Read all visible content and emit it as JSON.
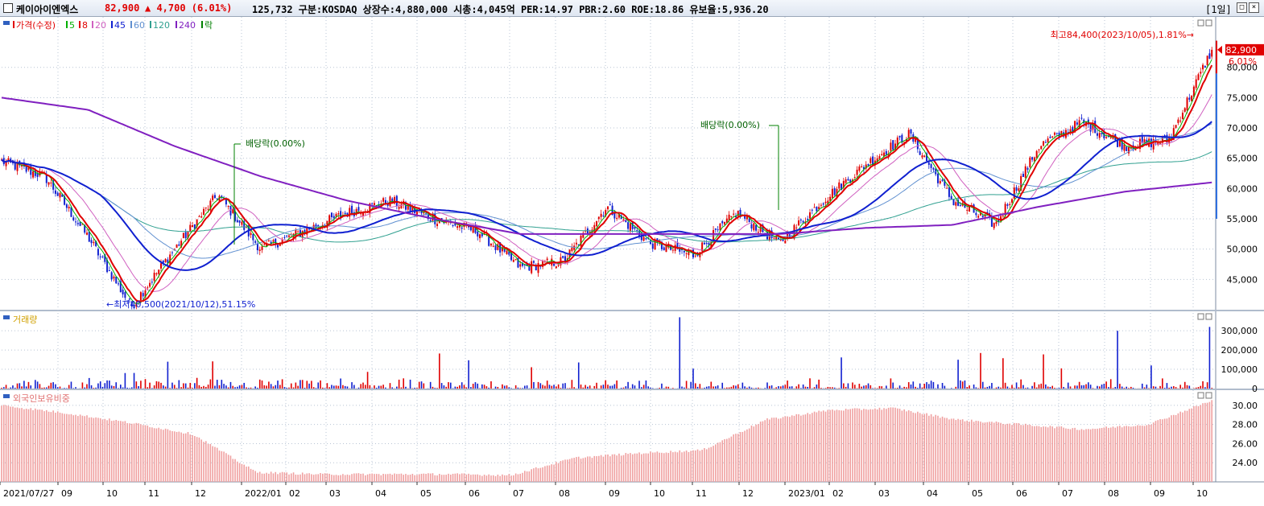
{
  "header": {
    "name": "케이아이엔엑스",
    "price": "82,900",
    "change": "▲ 4,700 (6.01%)",
    "info": "125,732  구분:KOSDAQ 상장수:4,880,000 시총:4,045억 PER:14.97 PBR:2.60 ROE:18.86 유보율:5,936.20",
    "period": "[1일]",
    "btn_max": "□",
    "btn_close": "×"
  },
  "price_panel": {
    "legend": [
      {
        "label": "가격(수정)",
        "color": "#e00000"
      },
      {
        "label": "5",
        "color": "#00b000"
      },
      {
        "label": "8",
        "color": "#e00000"
      },
      {
        "label": "20",
        "color": "#d060c0"
      },
      {
        "label": "45",
        "color": "#1020d0"
      },
      {
        "label": "60",
        "color": "#6090d0"
      },
      {
        "label": "120",
        "color": "#30a090"
      },
      {
        "label": "240",
        "color": "#8020c0"
      },
      {
        "label": "락",
        "color": "#008000"
      }
    ],
    "current_price_label": "82,900",
    "current_pct_label": "6.01%",
    "high_annotation": "최고84,400(2023/10/05),1.81%→",
    "low_annotation": "←최저40,500(2021/10/12),51.15%",
    "dividend1": "배당락(0.00%)",
    "dividend2": "배당락(0.00%)"
  },
  "volume_panel": {
    "legend": "거래량"
  },
  "foreign_panel": {
    "legend": "외국인보유비중"
  },
  "colors": {
    "up": "#e00000",
    "down": "#1020d0",
    "ma240": "#8020c0",
    "grid": "#b8c4d4"
  },
  "chart_data": [
    {
      "type": "line",
      "title": "가격(수정)",
      "y_ticks": [
        45000,
        50000,
        55000,
        60000,
        65000,
        70000,
        75000,
        80000
      ],
      "y_tick_labels": [
        "45,000",
        "50,000",
        "55,000",
        "60,000",
        "65,000",
        "70,000",
        "75,000",
        "80,000"
      ],
      "ylim": [
        40000,
        87000
      ],
      "x_labels": [
        "2021/07/27",
        "09",
        "10",
        "11",
        "12",
        "2022/01",
        "02",
        "03",
        "04",
        "05",
        "06",
        "07",
        "08",
        "09",
        "10",
        "11",
        "12",
        "2023/01",
        "02",
        "03",
        "04",
        "05",
        "06",
        "07",
        "08",
        "09",
        "10"
      ],
      "series": [
        {
          "name": "가격(수정)",
          "x": [
            "2021/07/27",
            "2021/08",
            "2021/09",
            "2021/10/12",
            "2021/11",
            "2021/11 late",
            "2021/12",
            "2022/01",
            "2022/02",
            "2022/03",
            "2022/04",
            "2022/05",
            "2022/06",
            "2022/07",
            "2022/08",
            "2022/09",
            "2022/10",
            "2022/11",
            "2022/12",
            "2023/01",
            "2023/02",
            "2023/03",
            "2023/04",
            "2023/05",
            "2023/06",
            "2023/07",
            "2023/08",
            "2023/09",
            "2023/10/05"
          ],
          "values": [
            64500,
            62000,
            52000,
            40500,
            50000,
            59000,
            50000,
            53000,
            56000,
            58000,
            55000,
            53000,
            47000,
            48000,
            57000,
            51000,
            49000,
            56000,
            51000,
            58000,
            64000,
            69000,
            58000,
            54000,
            67000,
            71000,
            67000,
            68000,
            82900
          ]
        },
        {
          "name": "240",
          "x": [
            "2021/07/27",
            "2021/09",
            "2021/11",
            "2022/01",
            "2022/03",
            "2022/05",
            "2022/07",
            "2022/09",
            "2022/11",
            "2023/01",
            "2023/03",
            "2023/05",
            "2023/07",
            "2023/09",
            "2023/10"
          ],
          "values": [
            75000,
            73000,
            67000,
            62000,
            58000,
            55000,
            52500,
            52500,
            52500,
            52500,
            53500,
            54000,
            57000,
            59500,
            61000
          ]
        }
      ]
    },
    {
      "type": "bar",
      "title": "거래량",
      "y_ticks": [
        0,
        100000,
        200000,
        300000
      ],
      "y_tick_labels": [
        "0",
        "100,000",
        "200,000",
        "300,000"
      ],
      "ylim": [
        0,
        380000
      ]
    },
    {
      "type": "area",
      "title": "외국인보유비중",
      "y_ticks": [
        24,
        26,
        28,
        30
      ],
      "y_tick_labels": [
        "24.00",
        "26.00",
        "28.00",
        "30.00"
      ],
      "ylim": [
        22,
        31
      ],
      "x": [
        "2021/07/27",
        "2021/09",
        "2021/10",
        "2021/11",
        "2021/12",
        "2022/02",
        "2022/04",
        "2022/06",
        "2022/08",
        "2022/09",
        "2022/11",
        "2023/01",
        "2023/02",
        "2023/04",
        "2023/05",
        "2023/06",
        "2023/07",
        "2023/08",
        "2023/09",
        "2023/10"
      ],
      "values": [
        30.0,
        29.2,
        28.2,
        27.0,
        23.0,
        22.8,
        22.8,
        22.8,
        22.7,
        24.5,
        25.0,
        25.3,
        28.5,
        29.5,
        29.7,
        28.5,
        28.0,
        27.5,
        28.0,
        30.5
      ]
    }
  ]
}
